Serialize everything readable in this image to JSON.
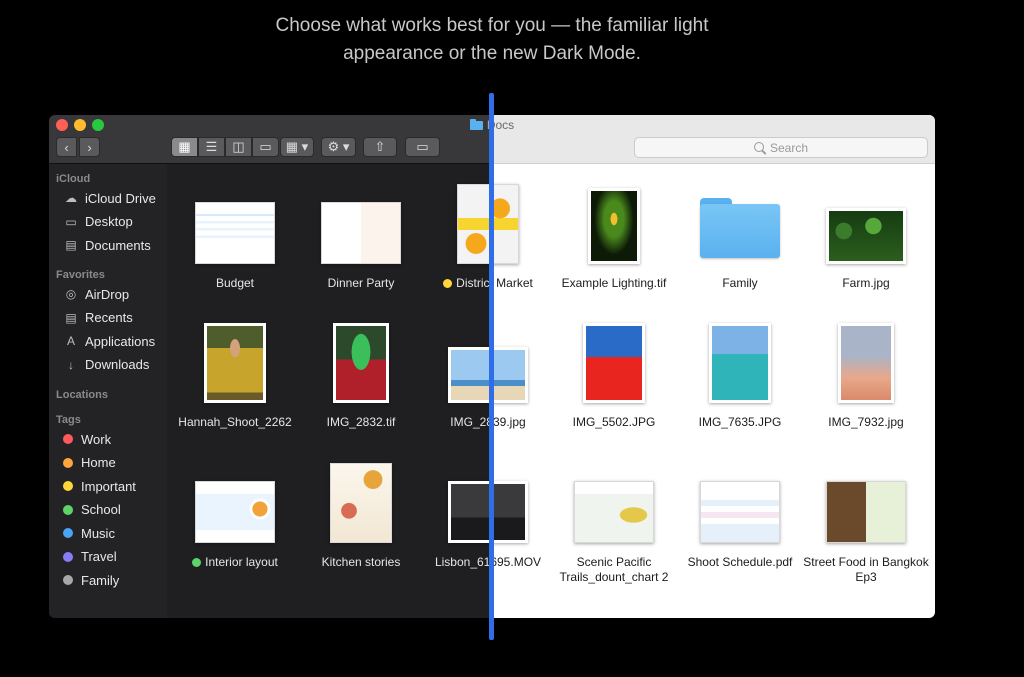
{
  "headline": {
    "line1": "Choose what works best for you — the familiar light",
    "line2": "appearance or the new Dark Mode."
  },
  "window": {
    "title": "Docs",
    "search_placeholder": "Search",
    "folder_icon_color": "#5ab1ef"
  },
  "toolbar": {
    "back": "‹",
    "forward": "›",
    "view_icons": "▦",
    "view_list": "☰",
    "view_columns": "◫",
    "view_gallery": "▭",
    "group": "▦ ▾",
    "action": "⚙ ▾",
    "share": "⇧",
    "tag": "▭"
  },
  "sidebar": {
    "sections": {
      "icloud": "iCloud",
      "favorites": "Favorites",
      "locations": "Locations",
      "tags": "Tags"
    },
    "icloud_items": [
      {
        "label": "iCloud Drive",
        "icon": "cloud-icon",
        "glyph": "☁"
      },
      {
        "label": "Desktop",
        "icon": "desktop-icon",
        "glyph": "▭"
      },
      {
        "label": "Documents",
        "icon": "document-icon",
        "glyph": "▤"
      }
    ],
    "favorite_items": [
      {
        "label": "AirDrop",
        "icon": "airdrop-icon",
        "glyph": "◎"
      },
      {
        "label": "Recents",
        "icon": "recents-icon",
        "glyph": "▤"
      },
      {
        "label": "Applications",
        "icon": "applications-icon",
        "glyph": "A"
      },
      {
        "label": "Downloads",
        "icon": "downloads-icon",
        "glyph": "↓"
      }
    ],
    "tags": [
      {
        "label": "Work",
        "color": "#ff5b5b"
      },
      {
        "label": "Home",
        "color": "#ffa53c"
      },
      {
        "label": "Important",
        "color": "#ffd73a"
      },
      {
        "label": "School",
        "color": "#5ed36a"
      },
      {
        "label": "Music",
        "color": "#4aa3f5"
      },
      {
        "label": "Travel",
        "color": "#8a7cf5"
      },
      {
        "label": "Family",
        "color": "#a8a8a8"
      }
    ]
  },
  "files": [
    {
      "name": "Budget",
      "kind": "sheet",
      "tag": ""
    },
    {
      "name": "Dinner Party",
      "kind": "menu",
      "tag": ""
    },
    {
      "name": "District Market",
      "kind": "poster",
      "tag": "#ffd73a"
    },
    {
      "name": "Example Lighting.tif",
      "kind": "plant",
      "tag": ""
    },
    {
      "name": "Family",
      "kind": "folder",
      "tag": ""
    },
    {
      "name": "Farm.jpg",
      "kind": "farm",
      "tag": ""
    },
    {
      "name": "Hannah_Shoot_2262",
      "kind": "portrait",
      "tag": ""
    },
    {
      "name": "IMG_2832.tif",
      "kind": "hat",
      "tag": ""
    },
    {
      "name": "IMG_2839.jpg",
      "kind": "beach",
      "tag": ""
    },
    {
      "name": "IMG_5502.JPG",
      "kind": "wall",
      "tag": ""
    },
    {
      "name": "IMG_7635.JPG",
      "kind": "teal",
      "tag": ""
    },
    {
      "name": "IMG_7932.jpg",
      "kind": "sunset",
      "tag": ""
    },
    {
      "name": "Interior layout",
      "kind": "layout",
      "tag": "#5ed36a"
    },
    {
      "name": "Kitchen stories",
      "kind": "market",
      "tag": ""
    },
    {
      "name": "Lisbon_61695.MOV",
      "kind": "movie",
      "tag": ""
    },
    {
      "name": "Scenic Pacific Trails_dount_chart 2",
      "kind": "chart",
      "tag": ""
    },
    {
      "name": "Shoot Schedule.pdf",
      "kind": "pdf",
      "tag": ""
    },
    {
      "name": "Street Food in Bangkok Ep3",
      "kind": "food",
      "tag": ""
    }
  ],
  "colors": {
    "accent_divider": "#2f6ee8",
    "dark_bg": "#1f1f21",
    "light_bg": "#ffffff"
  }
}
